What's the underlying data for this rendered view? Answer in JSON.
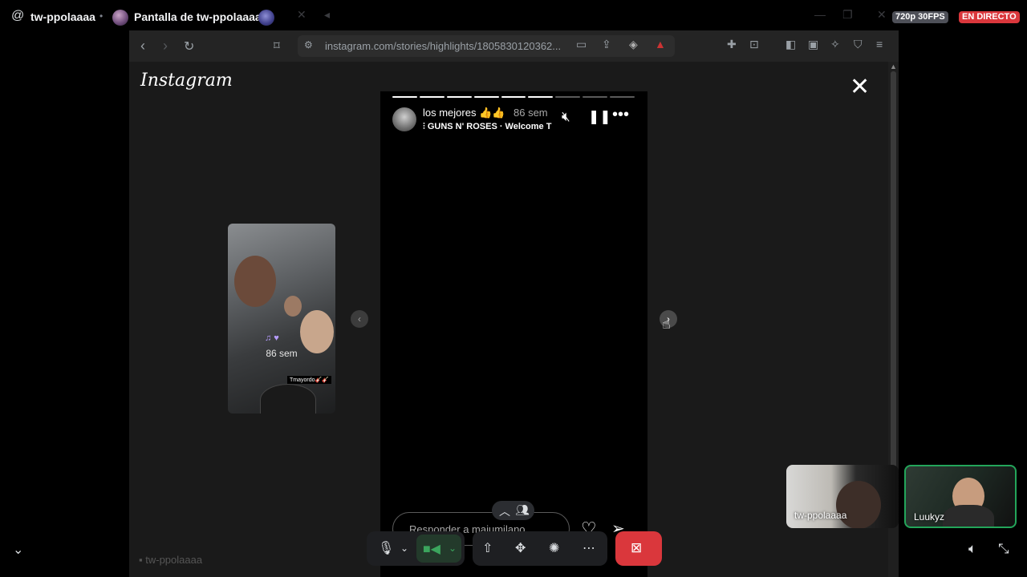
{
  "discord": {
    "at_symbol": "@",
    "channel_user": "tw-ppolaaaa",
    "separator": "•",
    "screen_title": "Pantalla de tw-ppolaaaa",
    "resolution_badge": "720p 30FPS",
    "live_badge": "EN DIRECTO",
    "accent_live": "#da373c",
    "speaking_color": "#23a55a"
  },
  "browser": {
    "url": "instagram.com/stories/highlights/1805830120362...",
    "watermark": "tw-ppolaaaa"
  },
  "instagram": {
    "logo": "Instagram",
    "story": {
      "progress_total": 9,
      "progress_filled": 6,
      "username": "los mejores 👍👍",
      "time": "86 sem",
      "music": "GUNS N' ROSES · Welcome T",
      "reply_placeholder": "Responder a maiumilano..."
    },
    "prev_story": {
      "time": "86 sem",
      "tag": "Tmayordo🎸🎸"
    }
  },
  "participants": [
    {
      "name": "tw-ppolaaaa"
    },
    {
      "name": "Luukyz"
    }
  ],
  "icons": {
    "back": "back-icon",
    "forward": "forward-icon",
    "reload": "reload-icon",
    "bookmark": "bookmark-icon",
    "mic": "microphone-icon",
    "camera": "camera-icon",
    "share_screen": "share-screen-icon",
    "activities": "activities-icon",
    "soundboard": "soundboard-icon",
    "more": "more-icon",
    "end_call": "end-call-icon"
  }
}
